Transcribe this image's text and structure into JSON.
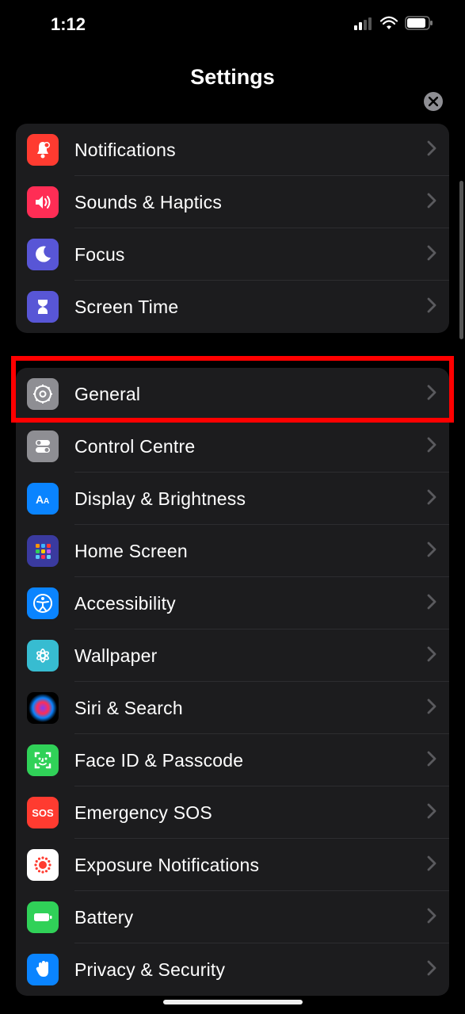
{
  "status": {
    "time": "1:12"
  },
  "header": {
    "title": "Settings"
  },
  "highlight": {
    "item_id": "general"
  },
  "sections": [
    {
      "items": [
        {
          "id": "notifications",
          "label": "Notifications",
          "icon": "bell-badge-icon",
          "bg": "#ff3b30"
        },
        {
          "id": "sounds",
          "label": "Sounds & Haptics",
          "icon": "speaker-wave-icon",
          "bg": "#ff2d55"
        },
        {
          "id": "focus",
          "label": "Focus",
          "icon": "moon-icon",
          "bg": "#5856d6"
        },
        {
          "id": "screentime",
          "label": "Screen Time",
          "icon": "hourglass-icon",
          "bg": "#5856d6"
        }
      ]
    },
    {
      "items": [
        {
          "id": "general",
          "label": "General",
          "icon": "gear-icon",
          "bg": "#8e8e93"
        },
        {
          "id": "controlcentre",
          "label": "Control Centre",
          "icon": "switches-icon",
          "bg": "#8e8e93"
        },
        {
          "id": "display",
          "label": "Display & Brightness",
          "icon": "aa-icon",
          "bg": "#0a84ff"
        },
        {
          "id": "homescreen",
          "label": "Home Screen",
          "icon": "grid-apps-icon",
          "bg": "#3a3a9f"
        },
        {
          "id": "accessibility",
          "label": "Accessibility",
          "icon": "accessibility-icon",
          "bg": "#0a84ff"
        },
        {
          "id": "wallpaper",
          "label": "Wallpaper",
          "icon": "flower-icon",
          "bg": "#37bcd1"
        },
        {
          "id": "siri",
          "label": "Siri & Search",
          "icon": "siri-icon",
          "bg": "#1c1c1e",
          "siri": true
        },
        {
          "id": "faceid",
          "label": "Face ID & Passcode",
          "icon": "faceid-icon",
          "bg": "#30d158"
        },
        {
          "id": "sos",
          "label": "Emergency SOS",
          "icon": "sos-icon",
          "bg": "#ff3b30"
        },
        {
          "id": "exposure",
          "label": "Exposure Notifications",
          "icon": "exposure-icon",
          "bg": "#ffffff"
        },
        {
          "id": "battery",
          "label": "Battery",
          "icon": "battery-icon",
          "bg": "#30d158"
        },
        {
          "id": "privacy",
          "label": "Privacy & Security",
          "icon": "hand-icon",
          "bg": "#0a84ff"
        }
      ]
    }
  ],
  "icons": {
    "chevron": "›"
  }
}
